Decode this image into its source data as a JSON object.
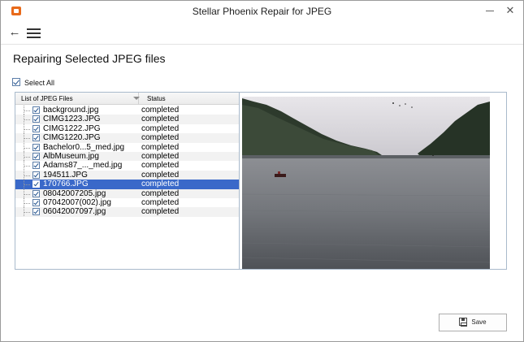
{
  "window": {
    "title": "Stellar Phoenix Repair for JPEG"
  },
  "toolbar": {
    "back_icon": "arrow-left-icon",
    "menu_icon": "hamburger-menu-icon"
  },
  "page": {
    "title": "Repairing Selected JPEG files"
  },
  "select_all": {
    "label": "Select All",
    "checked": true
  },
  "file_list": {
    "columns": [
      "List of JPEG Files",
      "Status"
    ],
    "selected_index": 8,
    "rows": [
      {
        "name": "background.jpg",
        "status": "completed",
        "checked": true
      },
      {
        "name": "CIMG1223.JPG",
        "status": "completed",
        "checked": true
      },
      {
        "name": "CIMG1222.JPG",
        "status": "completed",
        "checked": true
      },
      {
        "name": "CIMG1220.JPG",
        "status": "completed",
        "checked": true
      },
      {
        "name": "Bachelor0...5_med.jpg",
        "status": "completed",
        "checked": true
      },
      {
        "name": "AlbMuseum.jpg",
        "status": "completed",
        "checked": true
      },
      {
        "name": "Adams87_..._med.jpg",
        "status": "completed",
        "checked": true
      },
      {
        "name": "194511.JPG",
        "status": "completed",
        "checked": true
      },
      {
        "name": "170766.JPG",
        "status": "completed",
        "checked": true
      },
      {
        "name": "08042007205.jpg",
        "status": "completed",
        "checked": true
      },
      {
        "name": "07042007(002).jpg",
        "status": "completed",
        "checked": true
      },
      {
        "name": "06042007097.jpg",
        "status": "completed",
        "checked": true
      }
    ]
  },
  "preview": {
    "description_icon": "lake-landscape-photo"
  },
  "actions": {
    "save_label": "Save"
  },
  "colors": {
    "selection": "#3a69c9",
    "accent_icon": "#e86a1a",
    "panel_border": "#a9bacc"
  }
}
